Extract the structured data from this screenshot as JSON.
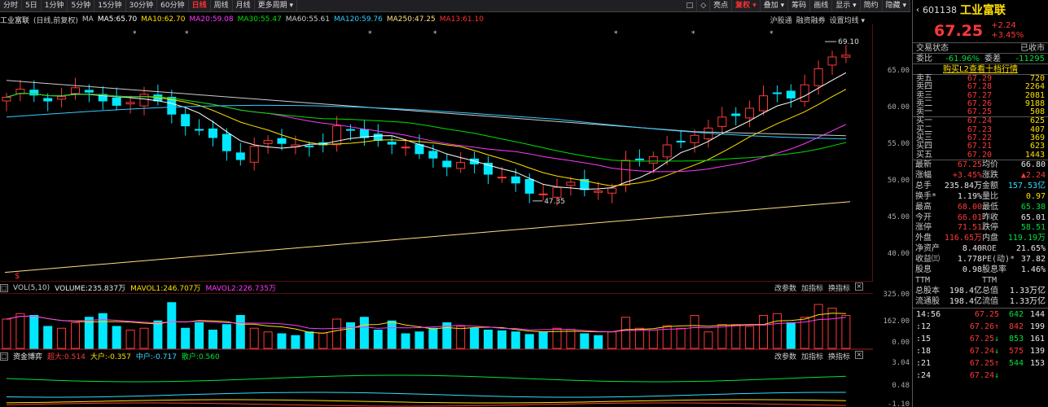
{
  "toolbar": {
    "left": [
      "分时",
      "5日",
      "1分钟",
      "5分钟",
      "15分钟",
      "30分钟",
      "60分钟",
      "日线",
      "周线",
      "月线",
      "更多周期 ▾"
    ],
    "active_index": 7,
    "right": [
      "□",
      "◇",
      "亮点",
      "复权 ▾",
      "叠加 ▾",
      "筹码",
      "画线",
      "显示 ▾",
      "简约",
      "隐藏 ▾"
    ]
  },
  "info": {
    "stock_name": "工业富联",
    "mode": "(日线,前复权)",
    "ma_label": "MA",
    "mas": [
      {
        "label": "MA5:65.70",
        "color": "#ffffff"
      },
      {
        "label": "MA10:62.70",
        "color": "#ffe000"
      },
      {
        "label": "MA20:59.08",
        "color": "#ff38ff"
      },
      {
        "label": "MA30:55.47",
        "color": "#00e000"
      },
      {
        "label": "MA60:55.61",
        "color": "#cccccc"
      },
      {
        "label": "MA120:59.76",
        "color": "#33ccff"
      },
      {
        "label": "MA250:47.25",
        "color": "#ffe080"
      },
      {
        "label": "MA13:61.10",
        "color": "#ff3030"
      }
    ],
    "right_links": [
      "沪股通",
      "融资融券",
      "设置均线 ▾"
    ]
  },
  "price_axis": [
    "65.00",
    "60.00",
    "55.00",
    "50.00",
    "45.00",
    "40.00"
  ],
  "annotations": {
    "high": "69.10",
    "low": "47.35",
    "dollar": "$"
  },
  "volume": {
    "title": "VOL(5,10)",
    "volume": "VOLUME:235.837万",
    "mavol1": "MAVOL1:246.707万",
    "mavol2": "MAVOL2:226.735万",
    "links": [
      "改参数",
      "加指标",
      "换指标"
    ],
    "axis": [
      "325.00",
      "162.00",
      "0.00"
    ]
  },
  "fund": {
    "title": "资金博弈",
    "super": "超大:0.514",
    "big": "大户:-0.357",
    "mid": "中户:-0.717",
    "small": "散户:0.560",
    "links": [
      "改参数",
      "加指标",
      "换指标"
    ],
    "axis": [
      "3.04",
      "0.48",
      "-1.10"
    ]
  },
  "side": {
    "code": "601138",
    "name": "工业富联",
    "price": "67.25",
    "change": "+2.24",
    "change_pct": "+3.45%",
    "status_label": "交易状态",
    "status": "已收市",
    "wei_bi_label": "委比",
    "wei_bi": "-61.96%",
    "wei_cha_label": "委差",
    "wei_cha": "-11295",
    "l2": "购买L2查看十档行情",
    "asks": [
      {
        "l": "卖五",
        "p": "67.29",
        "v": "720"
      },
      {
        "l": "卖四",
        "p": "67.28",
        "v": "2264"
      },
      {
        "l": "卖三",
        "p": "67.27",
        "v": "2081"
      },
      {
        "l": "卖二",
        "p": "67.26",
        "v": "9188"
      },
      {
        "l": "卖一",
        "p": "67.25",
        "v": "508"
      }
    ],
    "bids": [
      {
        "l": "买一",
        "p": "67.24",
        "v": "625"
      },
      {
        "l": "买二",
        "p": "67.23",
        "v": "407"
      },
      {
        "l": "买三",
        "p": "67.22",
        "v": "369"
      },
      {
        "l": "买四",
        "p": "67.21",
        "v": "623"
      },
      {
        "l": "买五",
        "p": "67.20",
        "v": "1443"
      }
    ],
    "stats": [
      [
        "最新",
        "67.25",
        "均价",
        "66.80"
      ],
      [
        "涨幅",
        "+3.45%",
        "涨跌",
        "▲2.24"
      ],
      [
        "总手",
        "235.84万",
        "金额",
        "157.53亿"
      ],
      [
        "换手*",
        "1.19%",
        "量比",
        "0.97"
      ],
      [
        "最高",
        "68.00",
        "最低",
        "65.38"
      ],
      [
        "今开",
        "66.01",
        "昨收",
        "65.01"
      ],
      [
        "涨停",
        "71.51",
        "跌停",
        "58.51"
      ],
      [
        "外盘",
        "116.65万",
        "内盘",
        "119.19万"
      ],
      [
        "净资产",
        "8.40",
        "ROE",
        "21.65%"
      ],
      [
        "收益㈢",
        "1.778",
        "PE(动)*",
        "37.82"
      ],
      [
        "股息TTM",
        "0.98",
        "股息率TTM",
        "1.46%"
      ],
      [
        "总股本",
        "198.4亿",
        "总值",
        "1.33万亿"
      ],
      [
        "流通股",
        "198.4亿",
        "流值",
        "1.33万亿"
      ]
    ],
    "ticks": [
      {
        "t": "14:56",
        "p": "67.25",
        "v": "642",
        "n": "144",
        "d": ""
      },
      {
        "t": ":12",
        "p": "67.26",
        "v": "842",
        "n": "199",
        "d": "↑"
      },
      {
        "t": ":15",
        "p": "67.25",
        "v": "853",
        "n": "161",
        "d": "↓"
      },
      {
        "t": ":18",
        "p": "67.24",
        "v": "575",
        "n": "139",
        "d": "↓"
      },
      {
        "t": ":21",
        "p": "67.25",
        "v": "544",
        "n": "153",
        "d": "↑"
      },
      {
        "t": ":24",
        "p": "67.24",
        "v": "",
        "n": "",
        "d": "↓"
      }
    ]
  },
  "colors": {
    "up": "#ff3838",
    "down": "#00e8ff",
    "bg": "#000000"
  }
}
